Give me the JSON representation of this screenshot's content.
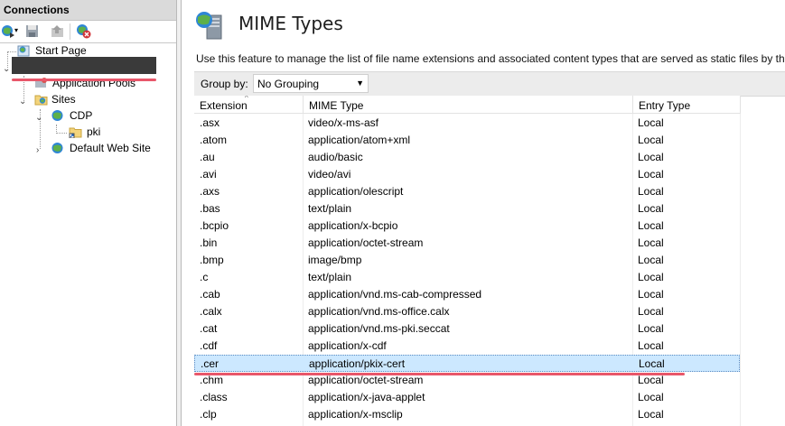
{
  "connections": {
    "header": "Connections",
    "tree": {
      "start_page": "Start Page",
      "application_pools": "Application Pools",
      "sites": "Sites",
      "cdp": "CDP",
      "pki": "pki",
      "default_web_site": "Default Web Site"
    }
  },
  "main": {
    "title": "MIME Types",
    "description": "Use this feature to manage the list of file name extensions and associated content types that are served as static files by the W",
    "group_by_label": "Group by:",
    "group_by_value": "No Grouping",
    "columns": [
      "Extension",
      "MIME Type",
      "Entry Type"
    ],
    "rows": [
      {
        "ext": ".asx",
        "mime": "video/x-ms-asf",
        "entry": "Local"
      },
      {
        "ext": ".atom",
        "mime": "application/atom+xml",
        "entry": "Local"
      },
      {
        "ext": ".au",
        "mime": "audio/basic",
        "entry": "Local"
      },
      {
        "ext": ".avi",
        "mime": "video/avi",
        "entry": "Local"
      },
      {
        "ext": ".axs",
        "mime": "application/olescript",
        "entry": "Local"
      },
      {
        "ext": ".bas",
        "mime": "text/plain",
        "entry": "Local"
      },
      {
        "ext": ".bcpio",
        "mime": "application/x-bcpio",
        "entry": "Local"
      },
      {
        "ext": ".bin",
        "mime": "application/octet-stream",
        "entry": "Local"
      },
      {
        "ext": ".bmp",
        "mime": "image/bmp",
        "entry": "Local"
      },
      {
        "ext": ".c",
        "mime": "text/plain",
        "entry": "Local"
      },
      {
        "ext": ".cab",
        "mime": "application/vnd.ms-cab-compressed",
        "entry": "Local"
      },
      {
        "ext": ".calx",
        "mime": "application/vnd.ms-office.calx",
        "entry": "Local"
      },
      {
        "ext": ".cat",
        "mime": "application/vnd.ms-pki.seccat",
        "entry": "Local"
      },
      {
        "ext": ".cdf",
        "mime": "application/x-cdf",
        "entry": "Local"
      },
      {
        "ext": ".cer",
        "mime": "application/pkix-cert",
        "entry": "Local",
        "selected": true
      },
      {
        "ext": ".chm",
        "mime": "application/octet-stream",
        "entry": "Local"
      },
      {
        "ext": ".class",
        "mime": "application/x-java-applet",
        "entry": "Local"
      },
      {
        "ext": ".clp",
        "mime": "application/x-msclip",
        "entry": "Local"
      }
    ]
  },
  "colors": {
    "selection": "#cce8ff",
    "annotation_red": "#e8576a",
    "groupbar_bg": "#ececec"
  }
}
